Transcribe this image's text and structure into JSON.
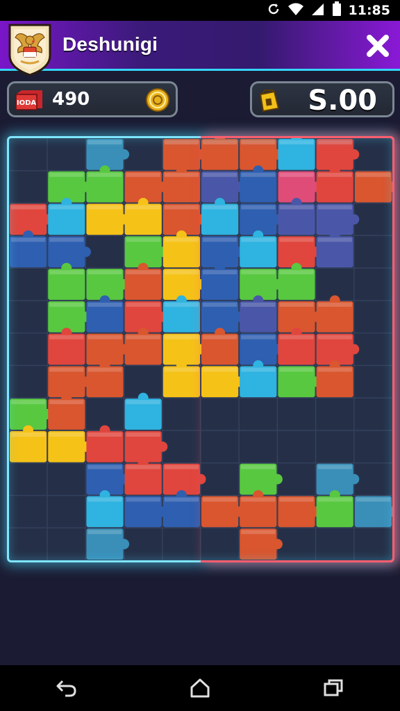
{
  "status_bar": {
    "time": "11:85",
    "icons": [
      "sync-icon",
      "wifi-icon",
      "signal-icon",
      "battery-icon"
    ]
  },
  "header": {
    "title": "Deshunigi",
    "avatar_icon": "garuda-emblem-icon",
    "close_icon": "close-x-icon",
    "gradient_colors": [
      "#7a16c9",
      "#3b1a7a",
      "#8a19d6"
    ],
    "accent_color": "#35d6ff"
  },
  "hud": {
    "box_badge": "IODA",
    "score": "490",
    "score_icon": "red-crate-icon",
    "coin_icon": "gold-coin-icon",
    "bag_icon": "yellow-bag-icon",
    "money": "S.00"
  },
  "board": {
    "grid_cols": 10,
    "grid_rows": 11,
    "frame_colors": [
      "#7fe6ff",
      "#ff5e6e"
    ],
    "palette": {
      "R": "#e0463d",
      "O": "#d9562f",
      "Y": "#f5c218",
      "G": "#58c840",
      "C": "#2fb3e0",
      "B": "#2f5fb0",
      "P": "#e04c78",
      "M": "#4a57a8",
      "T": "#3a8fb8"
    },
    "cells": [
      "..T.OOOCR.",
      ".GGOOMBPRO",
      "RCYYOCBMM.",
      "BB.GYBCRM.",
      ".GGOYBGG..",
      ".GBRCBMOO.",
      ".ROOYOBRR.",
      ".OO.YYCGO.",
      "GO.C......",
      "YYRR......",
      "..BRR.G.T.",
      "..CBBOOOGT",
      "..T...O..."
    ]
  },
  "nav_bar": {
    "buttons": [
      "back-icon",
      "home-icon",
      "recent-apps-icon"
    ]
  }
}
